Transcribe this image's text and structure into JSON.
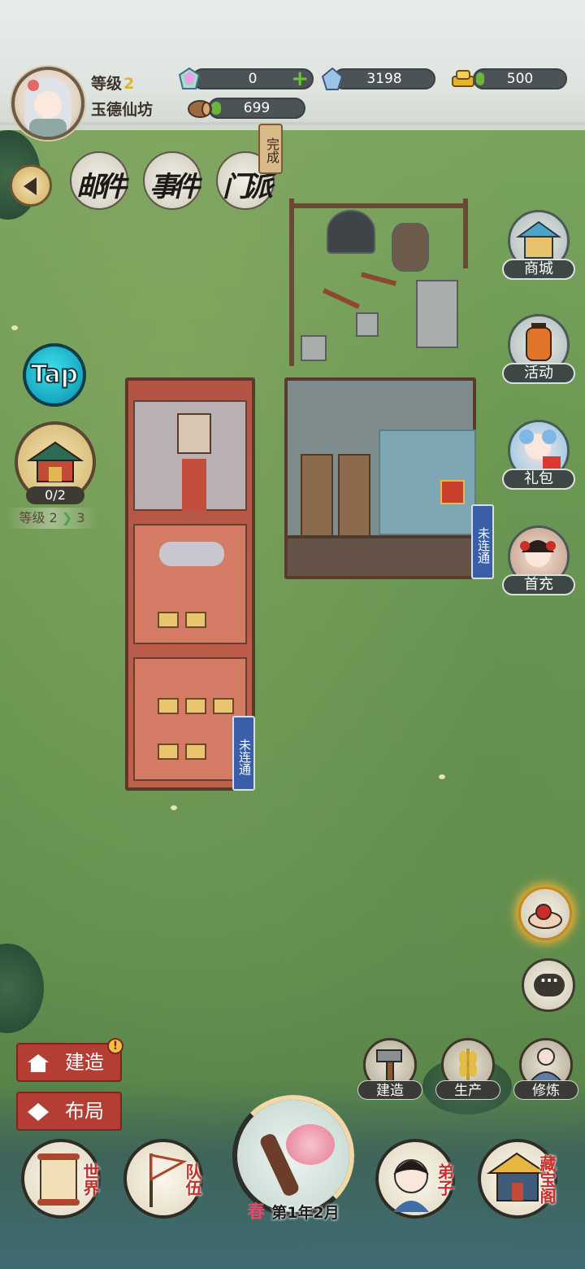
{
  "player": {
    "level_label": "等级",
    "level_value": "2",
    "sect_name": "玉德仙坊"
  },
  "resources": {
    "jade": "0",
    "spirit_stone": "3198",
    "gold": "500",
    "wood": "699"
  },
  "top_tabs": {
    "mail": "邮件",
    "event": "事件",
    "sect": "门派",
    "complete_tag": "完成"
  },
  "side_menu": {
    "shop": "商城",
    "activity": "活动",
    "gift": "礼包",
    "first_recharge": "首充"
  },
  "tap_label": "Tap",
  "pavilion": {
    "count": "0/2",
    "level_from": "等级 2",
    "level_to": "3"
  },
  "buildings": {
    "left_status": "未连通",
    "right_status": "未连通"
  },
  "left_actions": {
    "build": "建造",
    "layout": "布局",
    "alert": "!"
  },
  "chat_label": "···",
  "mid_actions": {
    "construct": "建造",
    "produce": "生产",
    "cultivate": "修炼"
  },
  "bottom_nav": {
    "world": "世界",
    "team": "队伍",
    "disciple": "弟子",
    "treasure": "藏宝阁"
  },
  "season": {
    "name": "春",
    "date": "第1年2月"
  },
  "colors": {
    "accent_red": "#b43e34",
    "tap_cyan": "#16a7bf",
    "tag_blue": "#3b5ea8",
    "progress_green": "#6cb53d"
  }
}
